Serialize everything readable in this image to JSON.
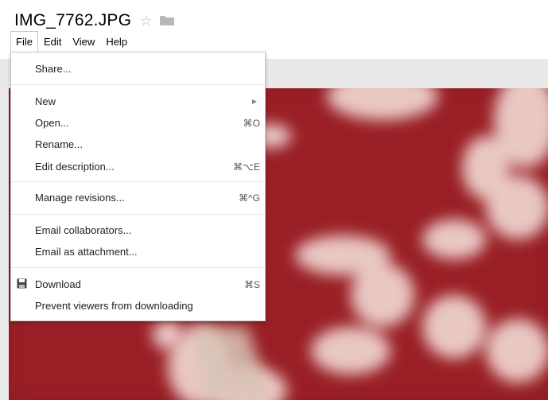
{
  "document": {
    "title": "IMG_7762.JPG",
    "star_icon": "star-icon",
    "folder_icon": "folder-icon"
  },
  "menubar": {
    "items": [
      {
        "label": "File",
        "active": true
      },
      {
        "label": "Edit",
        "active": false
      },
      {
        "label": "View",
        "active": false
      },
      {
        "label": "Help",
        "active": false
      }
    ]
  },
  "file_menu": {
    "share": {
      "label": "Share..."
    },
    "new": {
      "label": "New",
      "submenu": true
    },
    "open": {
      "label": "Open...",
      "shortcut": "⌘O"
    },
    "rename": {
      "label": "Rename..."
    },
    "edit_description": {
      "label": "Edit description...",
      "shortcut": "⌘⌥E"
    },
    "manage_revisions": {
      "label": "Manage revisions...",
      "shortcut": "⌘^G"
    },
    "email_collaborators": {
      "label": "Email collaborators..."
    },
    "email_attachment": {
      "label": "Email as attachment..."
    },
    "download": {
      "label": "Download",
      "shortcut": "⌘S",
      "icon": "floppy-disk-icon"
    },
    "prevent_download": {
      "label": "Prevent viewers from downloading"
    }
  },
  "colors": {
    "photo_red": "#8f1c22",
    "accent_border": "#c6c6c6"
  }
}
